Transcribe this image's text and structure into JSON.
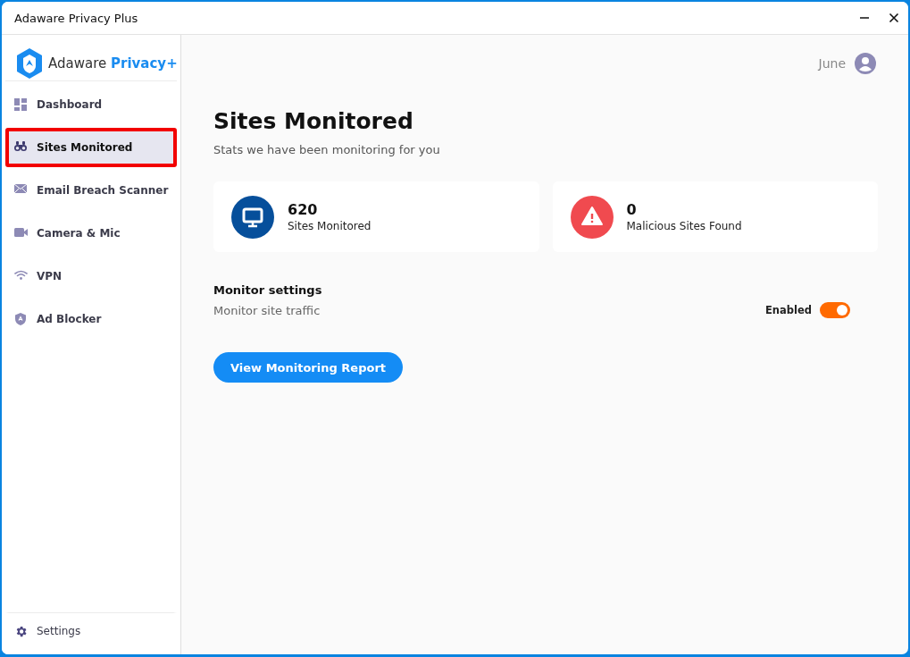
{
  "window": {
    "title": "Adaware Privacy Plus"
  },
  "sidebar": {
    "logo": {
      "brand": "Adaware",
      "product": "Privacy+"
    },
    "items": [
      {
        "label": "Dashboard",
        "kind": "grid",
        "selected": false
      },
      {
        "label": "Sites Monitored",
        "kind": "binoculars",
        "selected": true
      },
      {
        "label": "Email Breach Scanner",
        "kind": "envelope",
        "selected": false
      },
      {
        "label": "Camera & Mic",
        "kind": "camera",
        "selected": false
      },
      {
        "label": "VPN",
        "kind": "wifi",
        "selected": false
      },
      {
        "label": "Ad Blocker",
        "kind": "shield",
        "selected": false
      }
    ],
    "footer": {
      "label": "Settings"
    }
  },
  "user": {
    "name": "June"
  },
  "page": {
    "title": "Sites Monitored",
    "subtitle": "Stats we have been monitoring for you"
  },
  "stats": [
    {
      "value": "620",
      "label": "Sites Monitored",
      "kind": "monitor"
    },
    {
      "value": "0",
      "label": "Malicious Sites Found",
      "kind": "alert"
    }
  ],
  "settings": {
    "heading": "Monitor settings",
    "rows": [
      {
        "label": "Monitor site traffic",
        "status": "Enabled",
        "on": true
      }
    ]
  },
  "action": {
    "label": "View Monitoring Report"
  }
}
